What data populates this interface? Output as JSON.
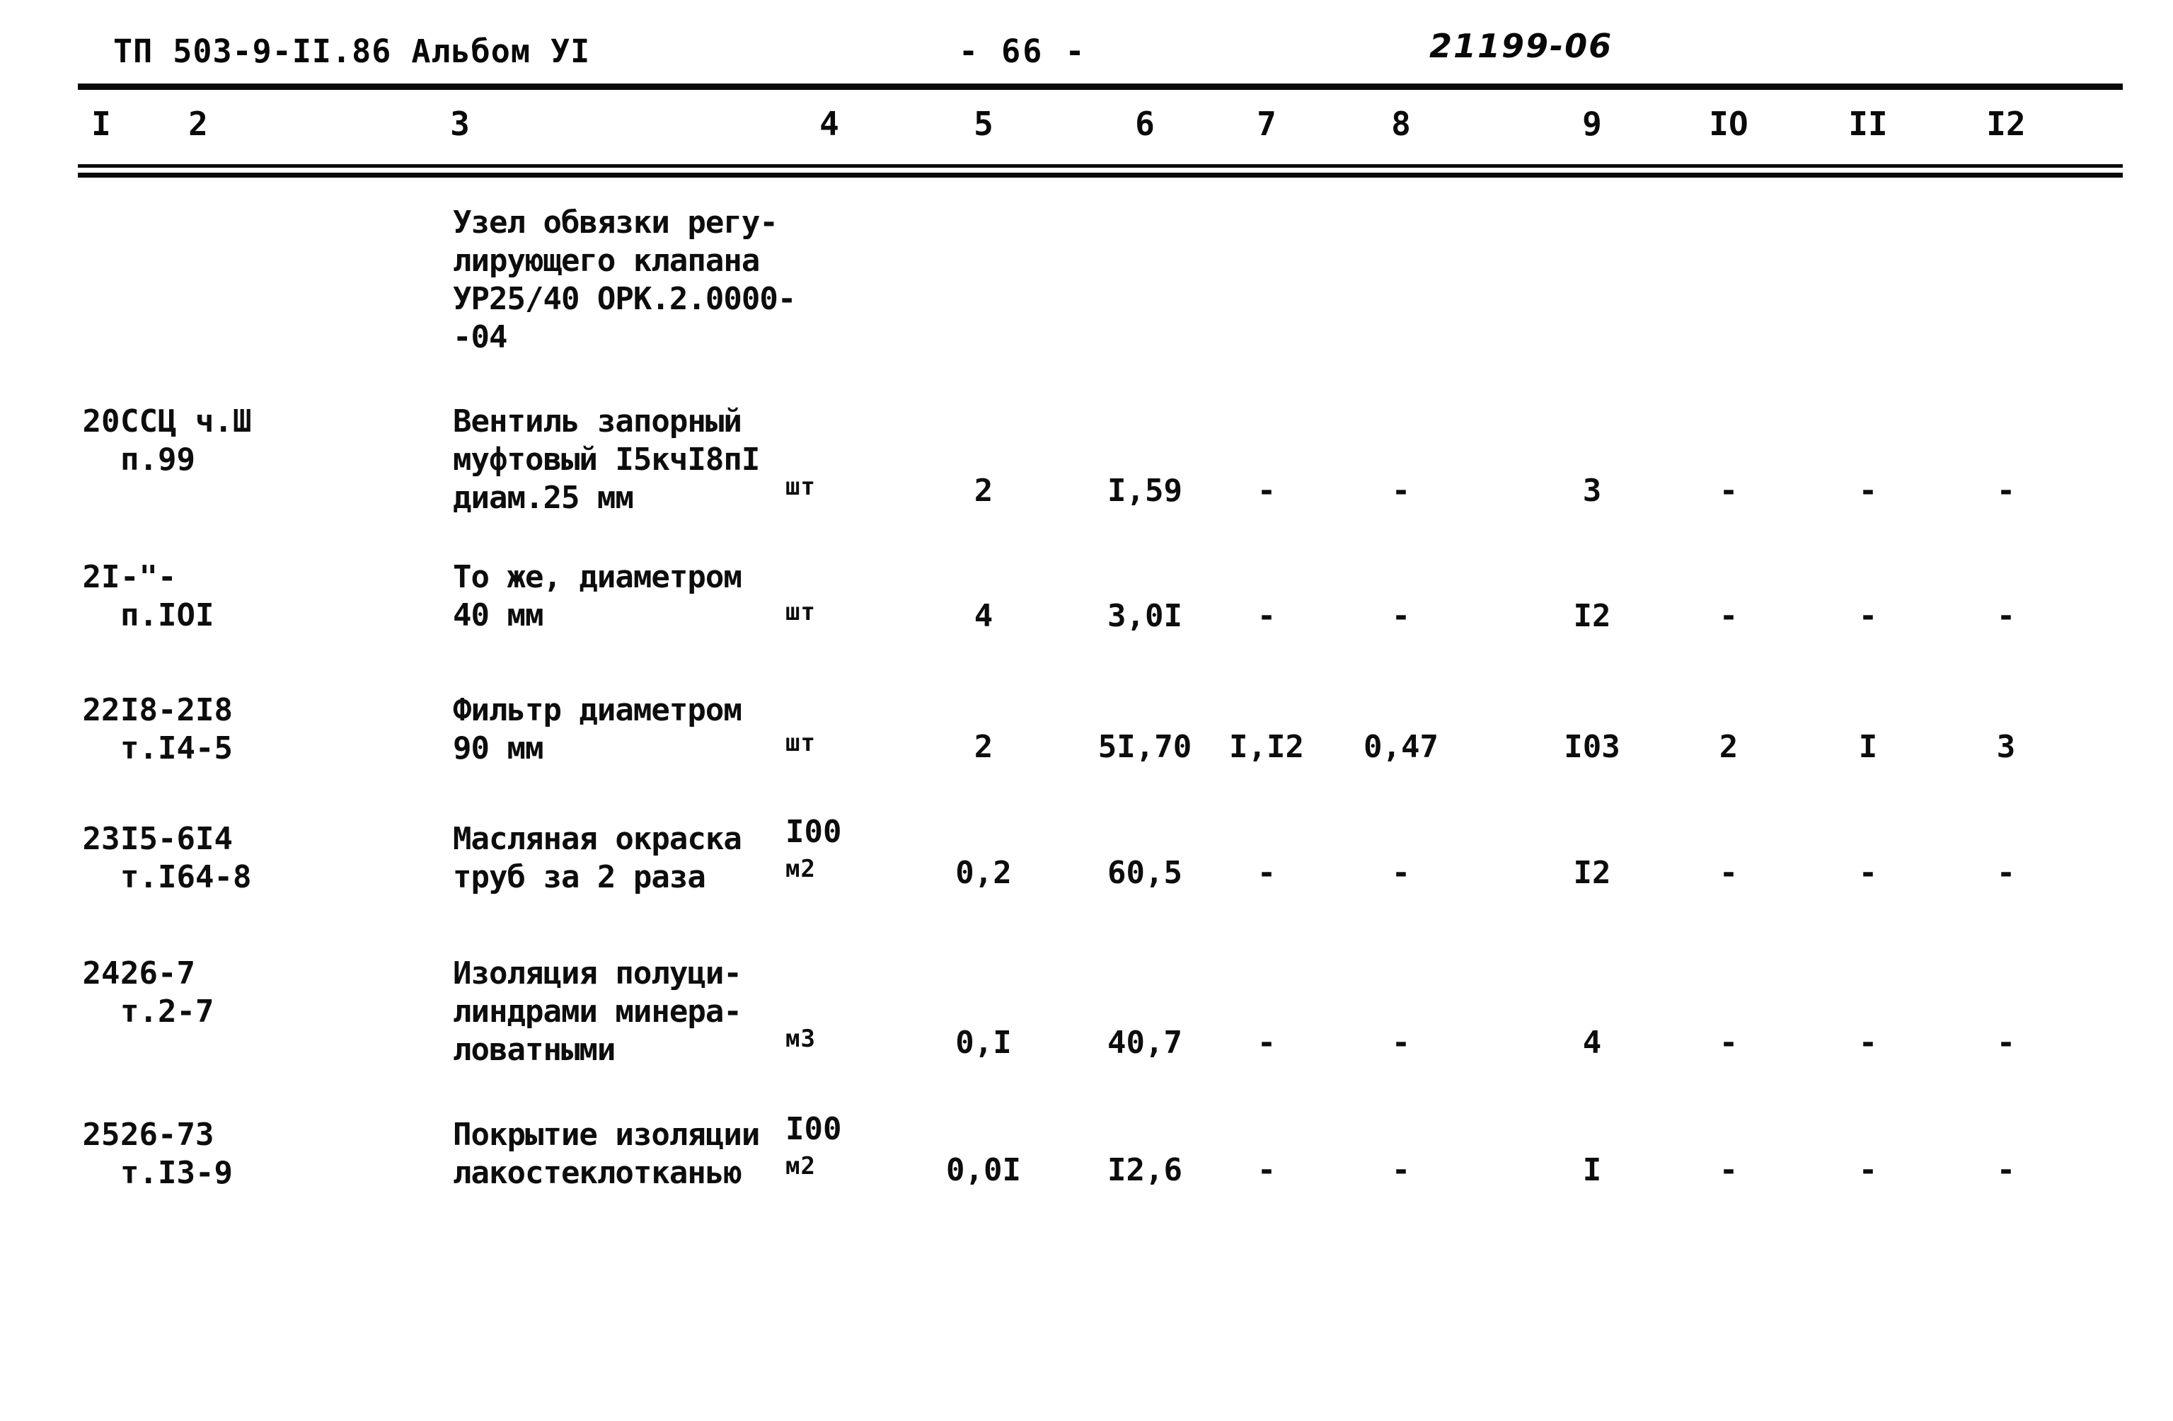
{
  "header": {
    "document_code": "ТП 503-9-II.86 Альбом УI",
    "page_number": "- 66 -",
    "archive_stamp": "21199-06"
  },
  "table": {
    "column_headers": [
      "I",
      "2",
      "3",
      "4",
      "5",
      "6",
      "7",
      "8",
      "9",
      "IO",
      "II",
      "I2"
    ],
    "intro_block": "Узел обвязки регу-\nлирующего клапана\nУР25/40 ОРК.2.0000-\n-04",
    "rows": [
      {
        "num": "20",
        "ref_line1": "ССЦ ч.Ш",
        "ref_line2": "п.99",
        "name_line1": "Вентиль запорный",
        "name_line2": "муфтовый I5кчI8пI",
        "name_line3": "диам.25 мм",
        "unit_line1": "",
        "unit_line2": "шт",
        "c5": "2",
        "c6": "I,59",
        "c7": "-",
        "c8": "-",
        "c9": "3",
        "c10": "-",
        "c11": "-",
        "c12": "-"
      },
      {
        "num": "2I",
        "ref_line1": "-\"-",
        "ref_line2": "п.IOI",
        "name_line1": "То же, диаметром",
        "name_line2": "40 мм",
        "name_line3": "",
        "unit_line1": "",
        "unit_line2": "шт",
        "c5": "4",
        "c6": "3,0I",
        "c7": "-",
        "c8": "-",
        "c9": "I2",
        "c10": "-",
        "c11": "-",
        "c12": "-"
      },
      {
        "num": "22",
        "ref_line1": "I8-2I8",
        "ref_line2": "т.I4-5",
        "name_line1": "Фильтр диаметром",
        "name_line2": "90 мм",
        "name_line3": "",
        "unit_line1": "",
        "unit_line2": "шт",
        "c5": "2",
        "c6": "5I,70",
        "c7": "I,I2",
        "c8": "0,47",
        "c9": "I03",
        "c10": "2",
        "c11": "I",
        "c12": "3"
      },
      {
        "num": "23",
        "ref_line1": "I5-6I4",
        "ref_line2": "т.I64-8",
        "name_line1": "Масляная окраска",
        "name_line2": "труб за 2 раза",
        "name_line3": "",
        "unit_line1": "I00",
        "unit_line2": "м2",
        "c5": "0,2",
        "c6": "60,5",
        "c7": "-",
        "c8": "-",
        "c9": "I2",
        "c10": "-",
        "c11": "-",
        "c12": "-"
      },
      {
        "num": "24",
        "ref_line1": "26-7",
        "ref_line2": "т.2-7",
        "name_line1": "Изоляция полуци-",
        "name_line2": "линдрами минера-",
        "name_line3": "ловатными",
        "unit_line1": "",
        "unit_line2": "м3",
        "c5": "0,I",
        "c6": "40,7",
        "c7": "-",
        "c8": "-",
        "c9": "4",
        "c10": "-",
        "c11": "-",
        "c12": "-"
      },
      {
        "num": "25",
        "ref_line1": "26-73",
        "ref_line2": "т.I3-9",
        "name_line1": "Покрытие изоляции",
        "name_line2": "лакостеклотканью",
        "name_line3": "",
        "unit_line1": "I00",
        "unit_line2": "м2",
        "c5": "0,0I",
        "c6": "I2,6",
        "c7": "-",
        "c8": "-",
        "c9": "I",
        "c10": "-",
        "c11": "-",
        "c12": "-"
      }
    ]
  }
}
